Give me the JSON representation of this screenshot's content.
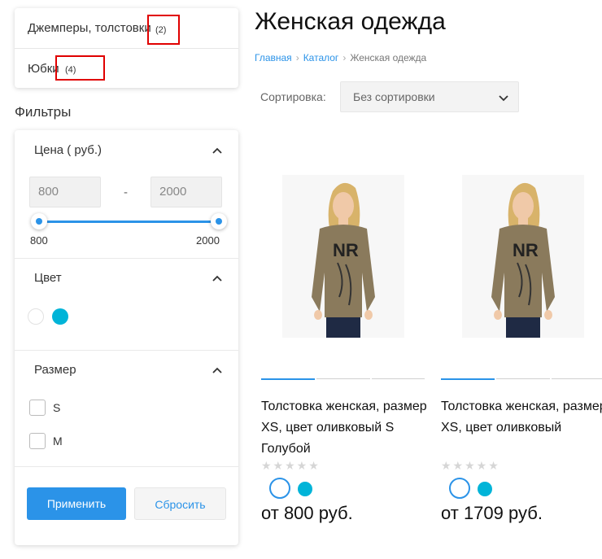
{
  "categories": [
    {
      "label": "Джемперы, толстовки",
      "count": "(2)"
    },
    {
      "label": "Юбки",
      "count": "(4)"
    }
  ],
  "filters": {
    "title": "Фильтры",
    "price": {
      "title": "Цена ( руб.)",
      "min_value": "800",
      "max_value": "2000",
      "range_min_label": "800",
      "range_max_label": "2000"
    },
    "color": {
      "title": "Цвет",
      "swatches": [
        "#ffffff",
        "#00b4d8"
      ]
    },
    "size": {
      "title": "Размер",
      "options": [
        "S",
        "M"
      ]
    },
    "apply_label": "Применить",
    "reset_label": "Сбросить"
  },
  "page": {
    "title": "Женская одежда",
    "breadcrumb": [
      "Главная",
      "Каталог",
      "Женская одежда"
    ]
  },
  "sort": {
    "label": "Сортировка:",
    "value": "Без сортировки"
  },
  "products": [
    {
      "name": "Толстовка женская, размер XS, цвет оливковый S Голубой",
      "price": "от 800 руб.",
      "rating": "★★★★★",
      "colors": [
        "#ffffff",
        "#00b4d8"
      ]
    },
    {
      "name": "Толстовка женская, размер XS, цвет оливковый",
      "price": "от 1709 руб.",
      "rating": "★★★★★",
      "colors": [
        "#ffffff",
        "#00b4d8"
      ]
    }
  ],
  "colors": {
    "accent": "#2b93e8",
    "highlight": "#e00000",
    "swatch_blue": "#00b4d8",
    "sweater": "#8a7a5c"
  }
}
